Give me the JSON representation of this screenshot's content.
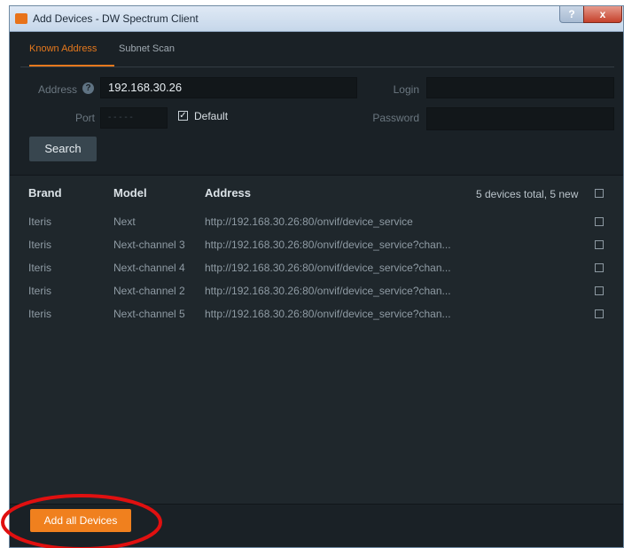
{
  "window": {
    "title": "Add Devices - DW Spectrum Client",
    "help_label": "?",
    "close_label": "x"
  },
  "tabs": [
    {
      "label": "Known Address",
      "active": true
    },
    {
      "label": "Subnet Scan",
      "active": false
    }
  ],
  "form": {
    "address_label": "Address",
    "address_value": "192.168.30.26",
    "port_label": "Port",
    "port_placeholder": "- - - - -",
    "default_label": "Default",
    "default_checked": true,
    "login_label": "Login",
    "login_value": "",
    "password_label": "Password",
    "password_value": "",
    "search_label": "Search"
  },
  "table": {
    "columns": [
      "Brand",
      "Model",
      "Address"
    ],
    "summary": "5 devices total, 5 new",
    "rows": [
      {
        "brand": "Iteris",
        "model": "Next",
        "address": "http://192.168.30.26:80/onvif/device_service"
      },
      {
        "brand": "Iteris",
        "model": "Next-channel 3",
        "address": "http://192.168.30.26:80/onvif/device_service?chan..."
      },
      {
        "brand": "Iteris",
        "model": "Next-channel 4",
        "address": "http://192.168.30.26:80/onvif/device_service?chan..."
      },
      {
        "brand": "Iteris",
        "model": "Next-channel 2",
        "address": "http://192.168.30.26:80/onvif/device_service?chan..."
      },
      {
        "brand": "Iteris",
        "model": "Next-channel 5",
        "address": "http://192.168.30.26:80/onvif/device_service?chan..."
      }
    ]
  },
  "footer": {
    "add_all_label": "Add all Devices"
  },
  "colors": {
    "accent": "#f0801e",
    "highlight_ring": "#e01010"
  }
}
